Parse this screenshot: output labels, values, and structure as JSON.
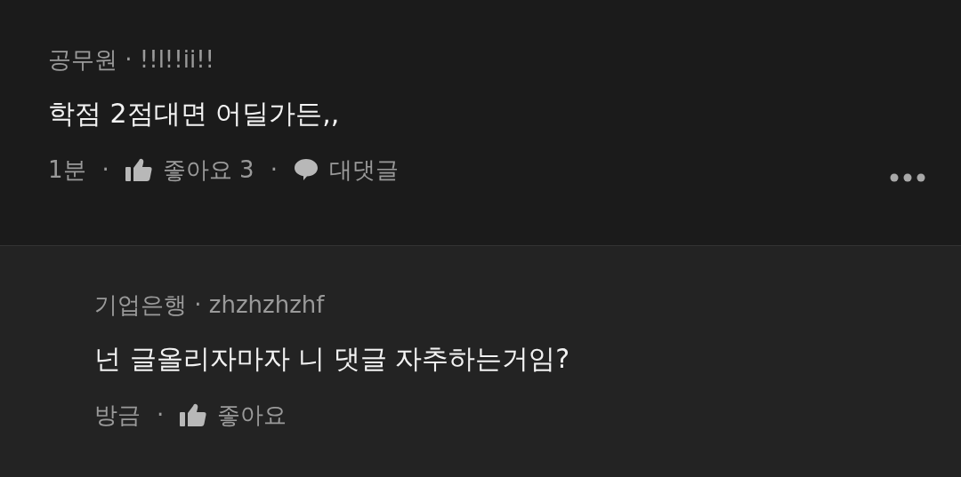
{
  "comments": [
    {
      "kind": "comment",
      "author": "공무원 · !!l!!ii!!",
      "body": "학점 2점대면 어딜가든,,",
      "time": "1분",
      "separator": "·",
      "like_label": "좋아요",
      "like_count": "3",
      "reply_label": "대댓글",
      "more_menu": true
    },
    {
      "kind": "reply",
      "author": "기업은행 · zhzhzhzhf",
      "body": "넌 글올리자마자 니 댓글 자추하는거임?",
      "time": "방금",
      "separator": "·",
      "like_label": "좋아요",
      "more_menu": false
    }
  ]
}
